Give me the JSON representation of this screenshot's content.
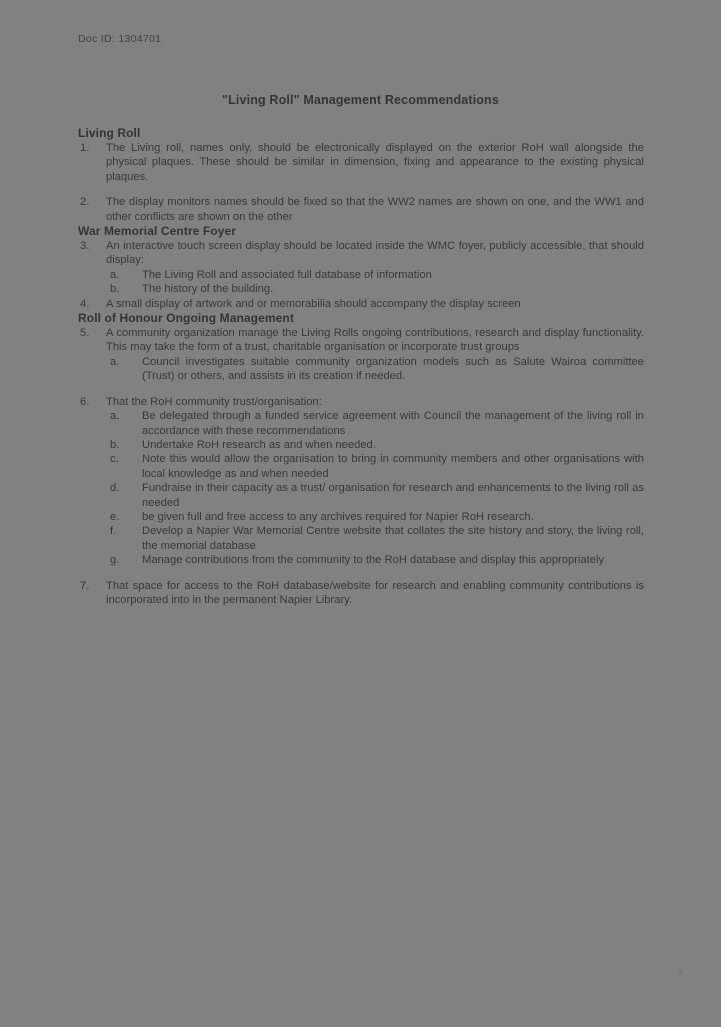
{
  "header": {
    "doc_id": "Doc ID: 1304701"
  },
  "title": "\"Living Roll\" Management Recommendations",
  "sections": [
    {
      "heading": "Living Roll",
      "items": [
        {
          "marker": "1.",
          "text": "The Living roll, names only, should be electronically displayed on the exterior RoH wall alongside the physical plaques. These should be similar in dimension, fixing and appearance to the existing physical plaques."
        },
        {
          "marker": "2.",
          "text": "The display monitors names should be fixed so that the WW2 names are shown on one, and the WW1 and other conflicts are shown on the other"
        }
      ]
    },
    {
      "heading": "War Memorial Centre Foyer",
      "items": [
        {
          "marker": "3.",
          "text": "An interactive touch screen display should be located inside the WMC foyer, publicly accessible, that should display:",
          "subitems": [
            {
              "marker": "a.",
              "text": "The Living Roll and associated full database of information"
            },
            {
              "marker": "b.",
              "text": "The history of the building."
            }
          ]
        },
        {
          "marker": "4.",
          "text": "A small display of artwork and or memorabilia should accompany the display screen"
        }
      ]
    },
    {
      "heading": "Roll of Honour Ongoing Management",
      "items": [
        {
          "marker": "5.",
          "text": "A community organization manage the Living Rolls ongoing contributions, research and display functionality.   This may take the form of a trust, charitable organisation or incorporate trust groups",
          "subitems": [
            {
              "marker": "a.",
              "text": "Council investigates suitable community organization models such as Salute Wairoa committee (Trust) or others, and assists in its creation if needed."
            }
          ]
        },
        {
          "marker": "6.",
          "text": "That the RoH community trust/organisation:",
          "subitems": [
            {
              "marker": "a.",
              "text": "Be delegated through a funded service agreement with Council the management of the living roll in accordance with these recommendations"
            },
            {
              "marker": "b.",
              "text": "Undertake RoH research as and when needed."
            },
            {
              "marker": "c.",
              "text": "Note this would allow the organisation to bring in community members and other organisations with local knowledge as and when needed"
            },
            {
              "marker": "d.",
              "text": "Fundraise in their capacity as a trust/ organisation for research and enhancements to the living roll as needed"
            },
            {
              "marker": "e.",
              "text": "be given full and free access to any archives required for Napier RoH research."
            },
            {
              "marker": "f.",
              "text": "Develop a Napier War Memorial Centre website that collates the site history and story, the living roll, the memorial database"
            },
            {
              "marker": "g.",
              "text": "Manage contributions from the community to the RoH database and display this appropriately"
            }
          ]
        },
        {
          "marker": "7.",
          "text": "That space for access to the RoH database/website for research and enabling community contributions is incorporated into in the permanent Napier Library."
        }
      ]
    }
  ],
  "footer": {
    "page_number": "8"
  }
}
